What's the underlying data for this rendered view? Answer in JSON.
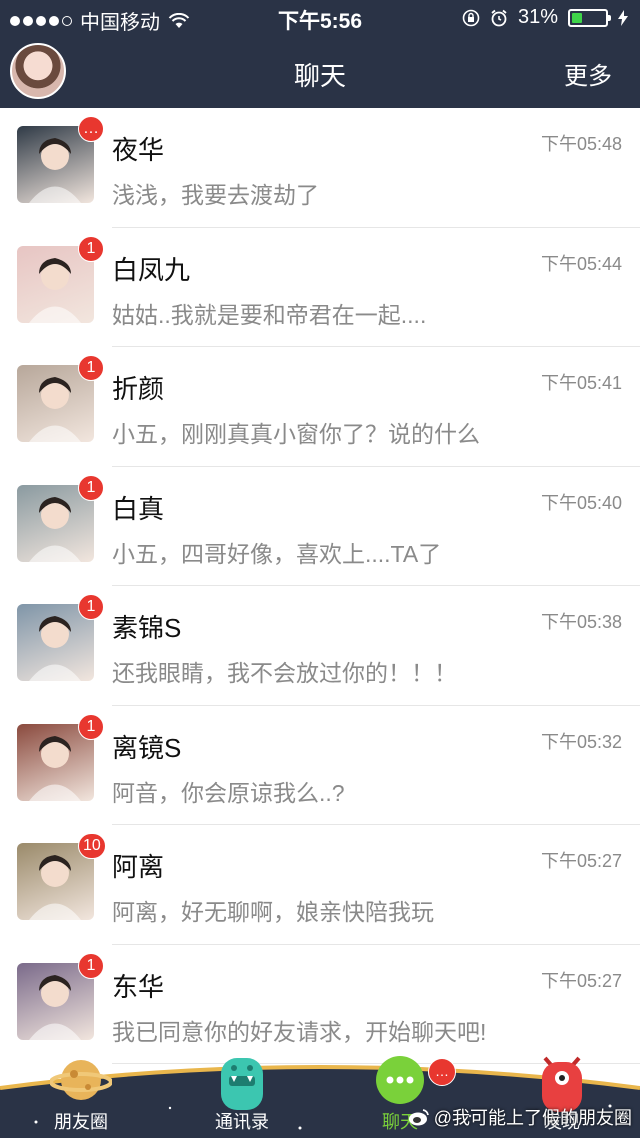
{
  "status_bar": {
    "carrier": "中国移动",
    "time": "下午5:56",
    "battery": "31%",
    "battery_level": 0.31
  },
  "nav": {
    "title": "聊天",
    "more": "更多"
  },
  "chats": [
    {
      "name": "夜华",
      "message": "浅浅，我要去渡劫了",
      "time": "下午05:48",
      "badge": "…",
      "avatar_color": "#2f3a46"
    },
    {
      "name": "白凤九",
      "message": "姑姑..我就是要和帝君在一起....",
      "time": "下午05:44",
      "badge": "1",
      "avatar_color": "#e7c5c3"
    },
    {
      "name": "折颜",
      "message": "小五，刚刚真真小窗你了？说的什么",
      "time": "下午05:41",
      "badge": "1",
      "avatar_color": "#b7a79a"
    },
    {
      "name": "白真",
      "message": "小五，四哥好像，喜欢上....TA了",
      "time": "下午05:40",
      "badge": "1",
      "avatar_color": "#8a9aa0"
    },
    {
      "name": "素锦S",
      "message": "还我眼睛，我不会放过你的！！！",
      "time": "下午05:38",
      "badge": "1",
      "avatar_color": "#7f95a8"
    },
    {
      "name": "离镜S",
      "message": "阿音，你会原谅我么..?",
      "time": "下午05:32",
      "badge": "1",
      "avatar_color": "#8a4a3e"
    },
    {
      "name": "阿离",
      "message": "阿离，好无聊啊，娘亲快陪我玩",
      "time": "下午05:27",
      "badge": "10",
      "avatar_color": "#9a8a6a"
    },
    {
      "name": "东华",
      "message": "我已同意你的好友请求，开始聊天吧!",
      "time": "下午05:27",
      "badge": "1",
      "avatar_color": "#7a6a8a"
    }
  ],
  "tabs": [
    {
      "label": "朋友圈",
      "icon": "planet-icon",
      "color": "#e8b45a"
    },
    {
      "label": "通讯录",
      "icon": "monster-teal-icon",
      "color": "#3cc6b0"
    },
    {
      "label": "聊天",
      "icon": "chat-bubble-icon",
      "color": "#7ad13a",
      "badge": "…"
    },
    {
      "label": "发现",
      "icon": "monster-red-icon",
      "color": "#e84040"
    }
  ],
  "watermark": "@我可能上了假的朋友圈"
}
